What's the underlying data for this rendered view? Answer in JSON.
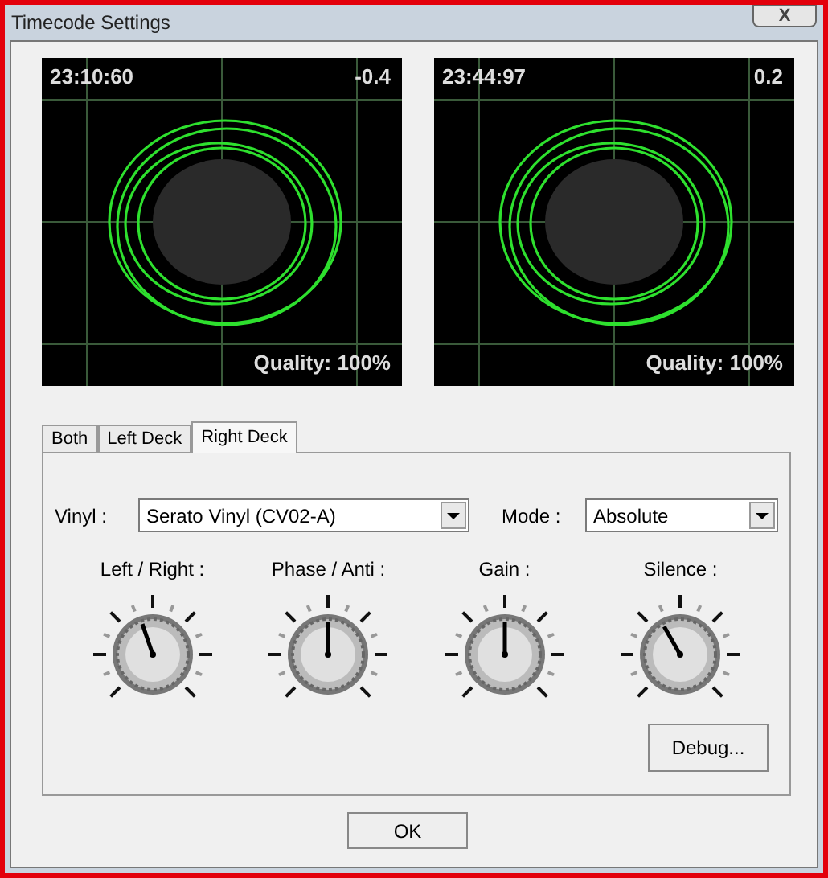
{
  "window": {
    "title": "Timecode Settings",
    "close_label": "X"
  },
  "scopes": [
    {
      "time": "23:10:60",
      "pitch": "-0.4",
      "quality": "Quality: 100%"
    },
    {
      "time": "23:44:97",
      "pitch": "0.2",
      "quality": "Quality: 100%"
    }
  ],
  "tabs": [
    {
      "label": "Both",
      "selected": false
    },
    {
      "label": "Left Deck",
      "selected": false
    },
    {
      "label": "Right Deck",
      "selected": true
    }
  ],
  "vinyl": {
    "label": "Vinyl :",
    "value": "Serato Vinyl (CV02-A)"
  },
  "mode": {
    "label": "Mode :",
    "value": "Absolute"
  },
  "knobs": [
    {
      "label": "Left / Right :",
      "level": 0.43
    },
    {
      "label": "Phase / Anti :",
      "level": 0.5
    },
    {
      "label": "Gain :",
      "level": 0.5
    },
    {
      "label": "Silence :",
      "level": 0.39
    }
  ],
  "buttons": {
    "debug": "Debug...",
    "ok": "OK"
  }
}
